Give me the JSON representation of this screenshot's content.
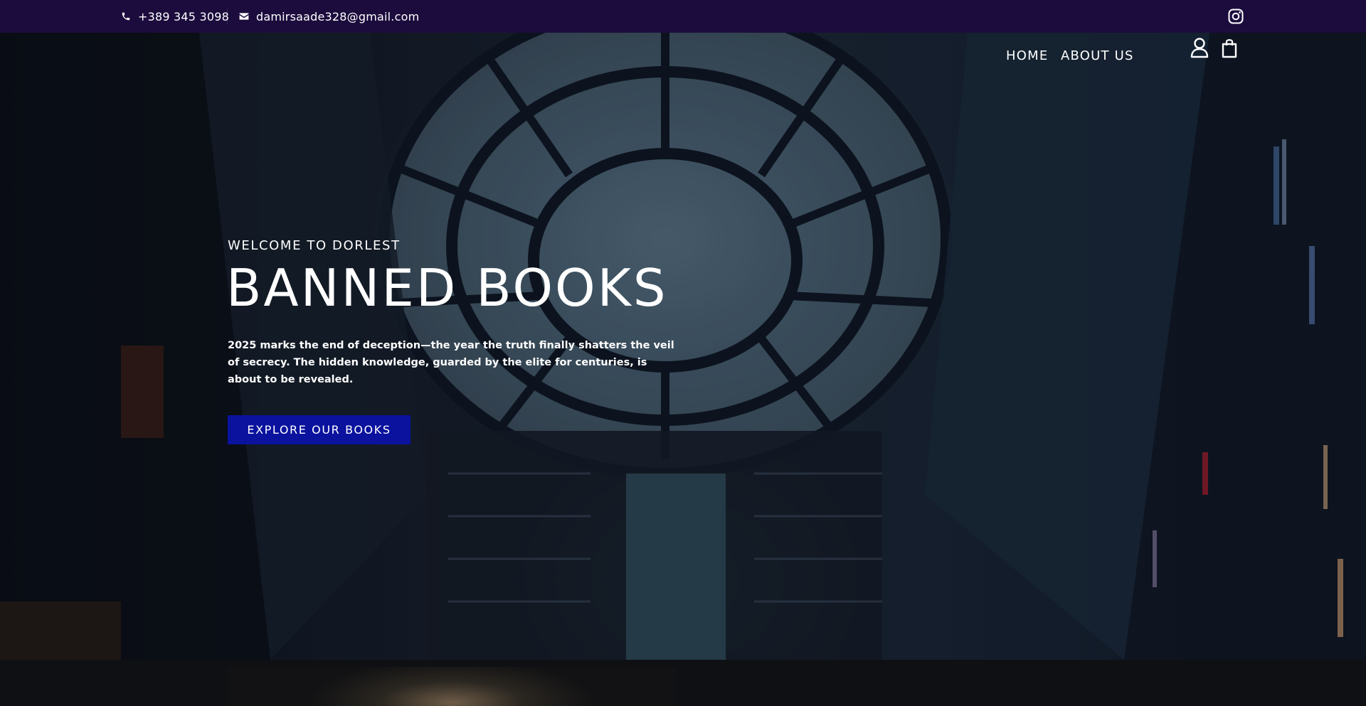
{
  "topbar": {
    "phone": "+389 345 3098",
    "email": "damirsaade328@gmail.com",
    "icons": {
      "phone": "phone-icon",
      "email": "mail-icon",
      "social": "instagram-icon"
    }
  },
  "nav": {
    "items": [
      {
        "label": "HOME"
      },
      {
        "label": "ABOUT US"
      }
    ],
    "icons": {
      "account": "user-icon",
      "cart": "shopping-bag-icon"
    }
  },
  "hero": {
    "eyebrow": "WELCOME TO DORLEST",
    "title": "BANNED BOOKS",
    "description": "2025 marks the end of deception—the year the truth finally shatters the veil of secrecy. The hidden knowledge, guarded by the elite for centuries, is about to be revealed.",
    "cta_label": "EXPLORE OUR BOOKS"
  },
  "colors": {
    "topbar_bg": "#1c0c3d",
    "cta_bg": "#0a129e",
    "text": "#ffffff"
  }
}
